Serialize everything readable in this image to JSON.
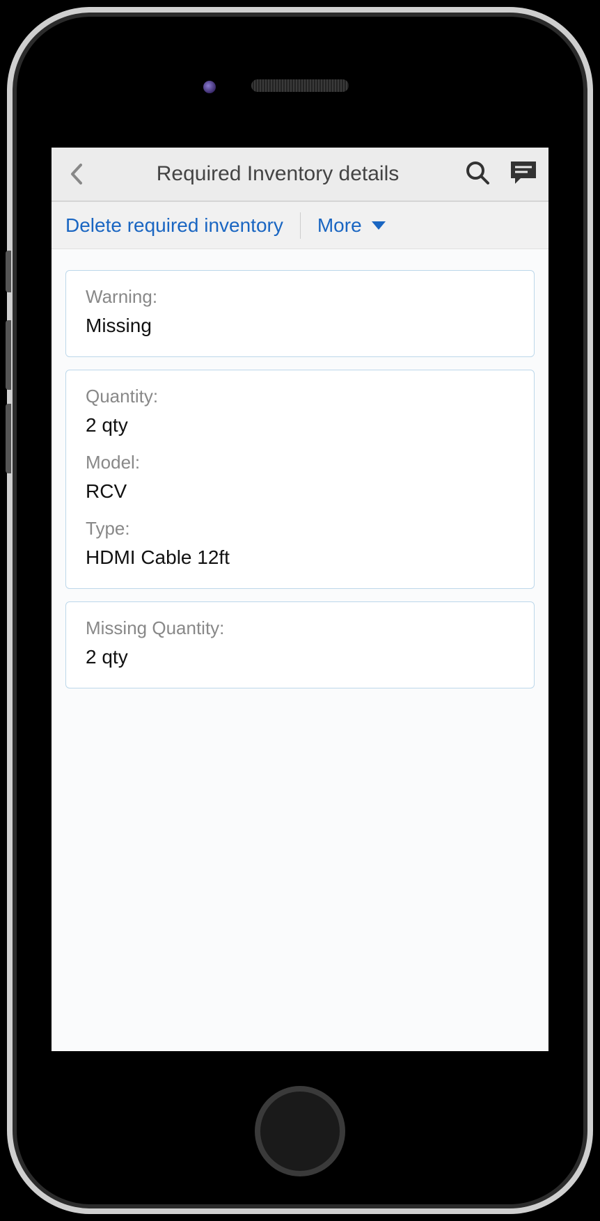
{
  "header": {
    "title": "Required Inventory details"
  },
  "actions": {
    "delete_label": "Delete required inventory",
    "more_label": "More"
  },
  "cards": {
    "warning": {
      "label": "Warning:",
      "value": "Missing"
    },
    "details": {
      "quantity_label": "Quantity:",
      "quantity_value": "2 qty",
      "model_label": "Model:",
      "model_value": "RCV",
      "type_label": "Type:",
      "type_value": "HDMI Cable 12ft"
    },
    "missing": {
      "label": "Missing Quantity:",
      "value": "2 qty"
    }
  }
}
